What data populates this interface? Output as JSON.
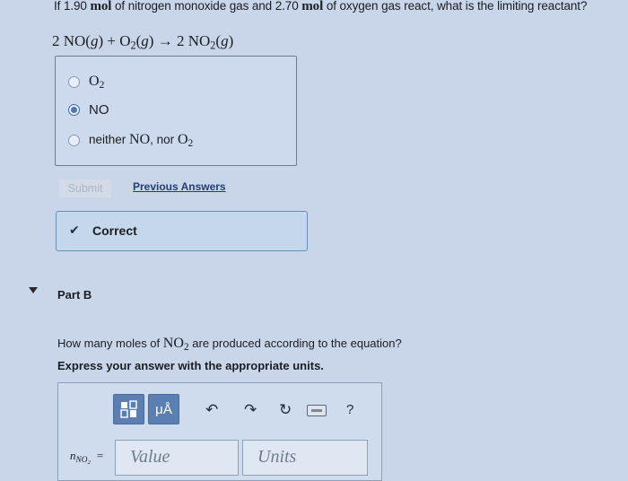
{
  "part_a": {
    "question_pre": "If 1.90",
    "question_unit1": "mol",
    "question_mid": "of nitrogen monoxide gas and 2.70",
    "question_unit2": "mol",
    "question_post": "of oxygen gas react, what is the limiting reactant?",
    "equation": {
      "t1": "2 NO(",
      "t2": "g",
      "t3": ") + O",
      "t4": "2",
      "t5": "(",
      "t6": "g",
      "t7": ") → 2 NO",
      "t8": "2",
      "t9": "(",
      "t10": "g",
      "t11": ")"
    },
    "options": [
      {
        "label": "O",
        "sub": "2",
        "selected": false
      },
      {
        "label": "NO",
        "selected": true
      },
      {
        "prefix": "neither",
        "label": "NO",
        "mid": ", nor",
        "label2": "O",
        "sub": "2",
        "selected": false
      }
    ],
    "submit_label": "Submit",
    "previous_answers_label": "Previous Answers",
    "feedback": "Correct"
  },
  "part_b": {
    "title": "Part B",
    "question_pre": "How many moles of",
    "question_formula": "NO",
    "question_sub": "2",
    "question_post": "are produced according to the equation?",
    "instruction": "Express your answer with the appropriate units.",
    "toolbar": {
      "template_icon": "fraction-template-icon",
      "units_label": "μÅ",
      "undo_icon": "undo-icon",
      "redo_icon": "redo-icon",
      "reset_icon": "reset-icon",
      "keyboard_icon": "keyboard-icon",
      "help_label": "?"
    },
    "lhs_var": "n",
    "lhs_sub": "NO",
    "lhs_sub2": "2",
    "lhs_eq": "=",
    "value_placeholder": "Value",
    "units_placeholder": "Units"
  },
  "colors": {
    "background": "#c9d6ea",
    "toolbar_button": "#5b7fb1",
    "link": "#1f3f77"
  }
}
